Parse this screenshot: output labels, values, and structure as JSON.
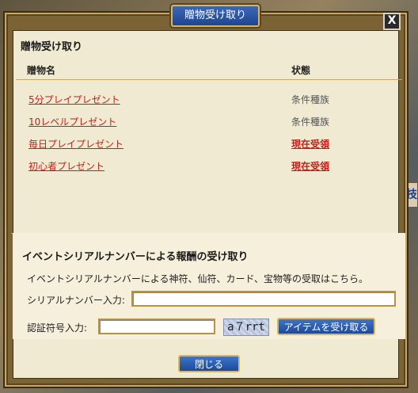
{
  "window": {
    "title": "贈物受け取り",
    "close_label": "X"
  },
  "gifts": {
    "section_title": "贈物受け取り",
    "col_name": "贈物名",
    "col_status": "状態",
    "rows": [
      {
        "name": "5分プレイプレゼント",
        "status": "条件種族",
        "claimable": false
      },
      {
        "name": "10レベルプレゼント",
        "status": "条件種族",
        "claimable": false
      },
      {
        "name": "毎日プレイプレゼント",
        "status": "現在受領",
        "claimable": true
      },
      {
        "name": "初心者プレゼント",
        "status": "現在受領",
        "claimable": true
      }
    ]
  },
  "serial": {
    "section_title": "イベントシリアルナンバーによる報酬の受け取り",
    "description": "イベントシリアルナンバーによる神符、仙符、カード、宝物等の受取はこちら。",
    "serial_label": "シリアルナンバー入力:",
    "serial_value": "",
    "auth_label": "認証符号入力:",
    "auth_value": "",
    "captcha_text": "a７rrt",
    "submit_label": "アイテムを受け取る"
  },
  "footer": {
    "close_button": "閉じる"
  },
  "background": {
    "side_char": "技"
  },
  "colors": {
    "accent_blue": "#1f4590",
    "link_red": "#c0211a",
    "panel_bg": "#f1ead2",
    "frame_gold": "#c9a864"
  }
}
